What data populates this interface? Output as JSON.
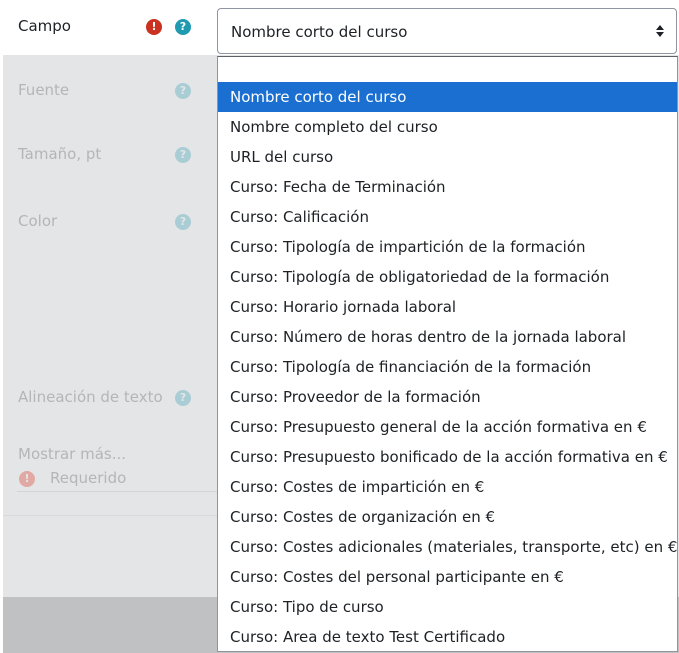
{
  "field": {
    "label": "Campo",
    "required_icon": "exclamation-icon",
    "help_icon": "question-icon",
    "selected_value": "Nombre corto del curso"
  },
  "background_form": {
    "fuente_label": "Fuente",
    "tamano_label": "Tamaño, pt",
    "color_label": "Color",
    "alineacion_label": "Alineación de texto",
    "mostrar_mas_label": "Mostrar más...",
    "requerido_label": "Requerido",
    "help_glyph": "?",
    "required_glyph": "!"
  },
  "dropdown": {
    "selected_index": 0,
    "options": [
      "Nombre corto del curso",
      "Nombre completo del curso",
      "URL del curso",
      "Curso: Fecha de Terminación",
      "Curso: Calificación",
      "Curso: Tipología de impartición de la formación",
      "Curso: Tipología de obligatoriedad de la formación",
      "Curso: Horario jornada laboral",
      "Curso: Número de horas dentro de la jornada laboral",
      "Curso: Tipología de financiación de la formación",
      "Curso: Proveedor de la formación",
      "Curso: Presupuesto general de la acción formativa en €",
      "Curso: Presupuesto bonificado de la acción formativa en €",
      "Curso: Costes de impartición en €",
      "Curso: Costes de organización en €",
      "Curso: Costes adicionales (materiales, transporte, etc) en €",
      "Curso: Costes del personal participante en €",
      "Curso: Tipo de curso",
      "Curso: Area de texto Test Certificado"
    ]
  },
  "colors": {
    "selected_option_bg": "#1a6fd0",
    "required_icon": "#ca3120",
    "help_icon": "#1f9ab0"
  }
}
